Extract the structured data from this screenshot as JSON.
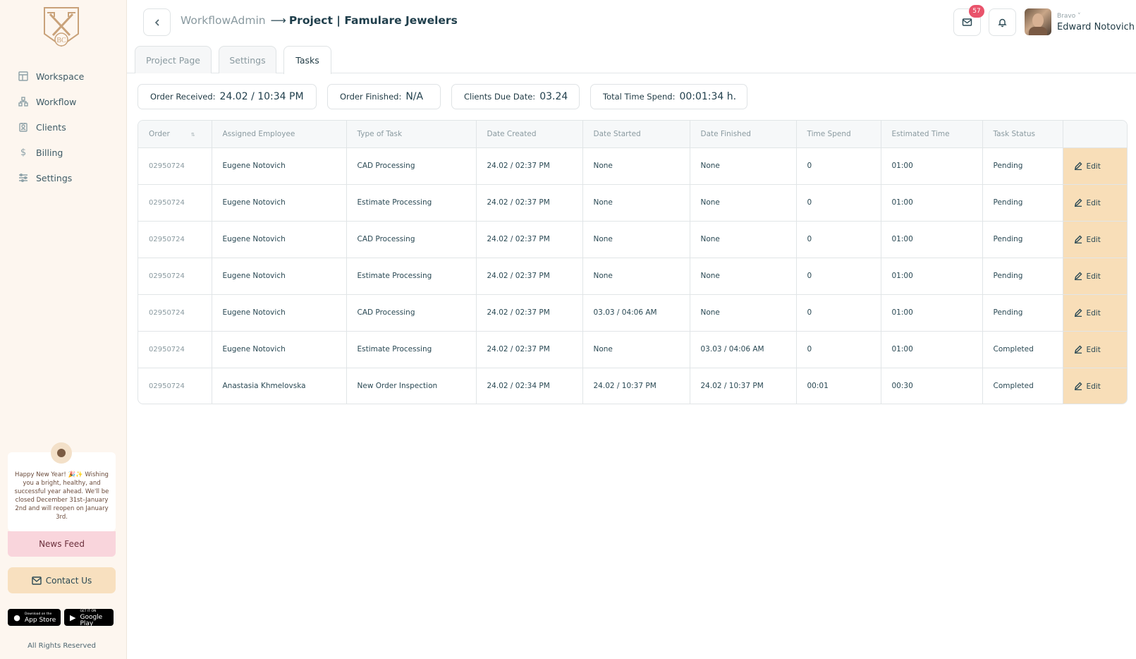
{
  "sidebar": {
    "logo_text": "BC",
    "items": [
      {
        "label": "Workspace",
        "icon": "layout-icon"
      },
      {
        "label": "Workflow",
        "icon": "workflow-icon"
      },
      {
        "label": "Clients",
        "icon": "clients-icon"
      },
      {
        "label": "Billing",
        "icon": "dollar-icon"
      },
      {
        "label": "Settings",
        "icon": "sliders-icon"
      }
    ],
    "news_text": "Happy New Year! 🎉✨ Wishing you a bright, healthy, and successful year ahead. We'll be closed December 31st–January 2nd and will reopen on January 3rd.",
    "news_button": "News Feed",
    "contact_button": "Contact Us",
    "app_store": {
      "small": "Download on the",
      "big": "App Store"
    },
    "google_play": {
      "small": "GET IT ON",
      "big": "Google Play"
    },
    "rights": "All Rights Reserved"
  },
  "header": {
    "breadcrumb_root": "WorkflowAdmin",
    "breadcrumb_arrow": "⟶",
    "breadcrumb_current": "Project | Famulare Jewelers",
    "mail_badge": "57",
    "user_role": "Bravo ˅",
    "user_name": "Edward Notovich"
  },
  "tabs": [
    "Project Page",
    "Settings",
    "Tasks"
  ],
  "active_tab": "Tasks",
  "summary": {
    "order_received_label": "Order Received:",
    "order_received_value": "24.02 / 10:34 PM",
    "order_finished_label": "Order Finished:",
    "order_finished_value": "N/A",
    "due_date_label": "Clients Due Date:",
    "due_date_value": "03.24",
    "time_spend_label": "Total Time Spend:",
    "time_spend_value": "00:01:34 h."
  },
  "table": {
    "sort_icon": "⇅",
    "columns": [
      "Order",
      "Assigned Employee",
      "Type of Task",
      "Date Created",
      "Date Started",
      "Date Finished",
      "Time Spend",
      "Estimated Time",
      "Task Status",
      ""
    ],
    "edit_label": "Edit",
    "rows": [
      [
        "02950724",
        "Eugene Notovich",
        "CAD Processing",
        "24.02 / 02:37 PM",
        "None",
        "None",
        "0",
        "01:00",
        "Pending"
      ],
      [
        "02950724",
        "Eugene Notovich",
        "Estimate Processing",
        "24.02 / 02:37 PM",
        "None",
        "None",
        "0",
        "01:00",
        "Pending"
      ],
      [
        "02950724",
        "Eugene Notovich",
        "CAD Processing",
        "24.02 / 02:37 PM",
        "None",
        "None",
        "0",
        "01:00",
        "Pending"
      ],
      [
        "02950724",
        "Eugene Notovich",
        "Estimate Processing",
        "24.02 / 02:37 PM",
        "None",
        "None",
        "0",
        "01:00",
        "Pending"
      ],
      [
        "02950724",
        "Eugene Notovich",
        "CAD Processing",
        "24.02 / 02:37 PM",
        "03.03 / 04:06 AM",
        "None",
        "0",
        "01:00",
        "Pending"
      ],
      [
        "02950724",
        "Eugene Notovich",
        "Estimate Processing",
        "24.02 / 02:37 PM",
        "None",
        "03.03 / 04:06 AM",
        "0",
        "01:00",
        "Completed"
      ],
      [
        "02950724",
        "Anastasia Khmelovska",
        "New Order Inspection",
        "24.02 / 02:34 PM",
        "24.02 / 10:37 PM",
        "24.02 / 10:37 PM",
        "00:01",
        "00:30",
        "Completed"
      ]
    ]
  }
}
